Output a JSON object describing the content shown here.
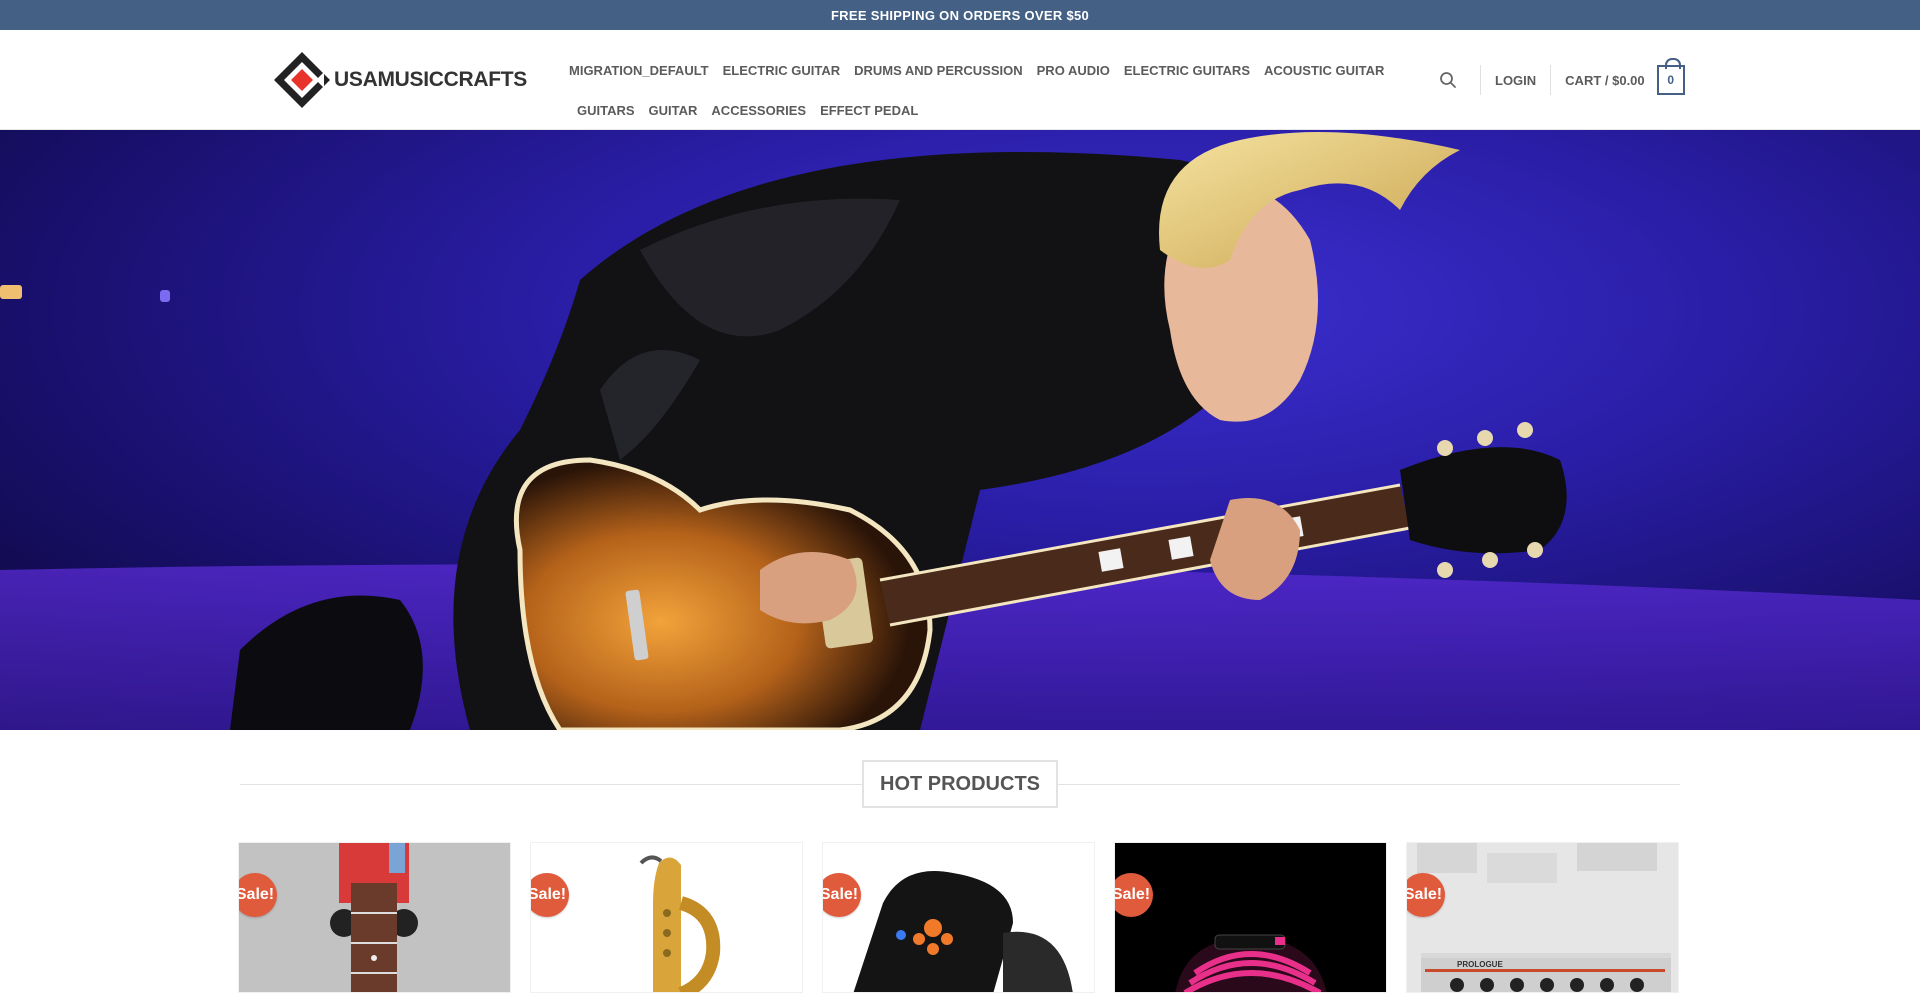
{
  "topbar": {
    "text": "FREE SHIPPING ON ORDERS OVER $50"
  },
  "brand": {
    "name": "USAMUSICCRAFTS",
    "accent": "#e8322c",
    "primary": "#446084"
  },
  "nav": {
    "row1": [
      "MIGRATION_DEFAULT",
      "ELECTRIC GUITAR",
      "DRUMS AND PERCUSSION",
      "PRO AUDIO",
      "ELECTRIC GUITARS",
      "ACOUSTIC GUITAR"
    ],
    "row2": [
      "GUITARS",
      "GUITAR",
      "ACCESSORIES",
      "EFFECT PEDAL"
    ]
  },
  "header": {
    "login": "LOGIN",
    "cart_label": "CART / $0.00",
    "cart_count": "0",
    "search_icon": "search-icon"
  },
  "hero": {
    "image": "guitarist-performing-on-stage"
  },
  "section": {
    "title": "HOT PRODUCTS"
  },
  "products": [
    {
      "badge": "Sale!",
      "image": "bass-guitar-neck"
    },
    {
      "badge": "Sale!",
      "image": "baritone-saxophone"
    },
    {
      "badge": "Sale!",
      "image": "clip-on-tuner"
    },
    {
      "badge": "Sale!",
      "image": "pink-patch-cables"
    },
    {
      "badge": "Sale!",
      "image": "prologue-amplifier"
    }
  ]
}
